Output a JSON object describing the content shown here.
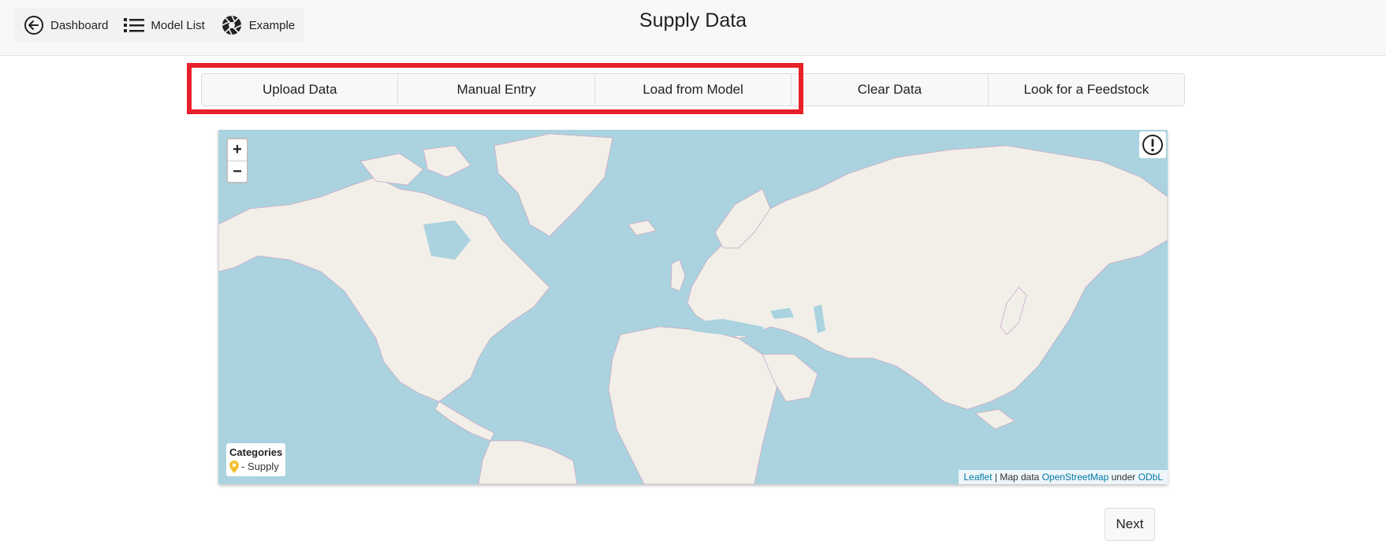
{
  "nav": {
    "dashboard": {
      "label": "Dashboard",
      "icon": "arrow-left-circle-icon"
    },
    "model_list": {
      "label": "Model List",
      "icon": "list-icon"
    },
    "example": {
      "label": "Example",
      "icon": "aperture-icon"
    }
  },
  "page_title": "Supply Data",
  "toolbar": {
    "upload": "Upload Data",
    "manual": "Manual Entry",
    "load_model": "Load from Model",
    "clear": "Clear Data",
    "feedstock": "Look for a Feedstock"
  },
  "highlight_color": "#e8202a",
  "map": {
    "zoom_in": "+",
    "zoom_out": "−",
    "info_icon": "exclamation-circle-icon",
    "legend": {
      "title": "Categories",
      "item": "- Supply",
      "marker_color": "#f2c230"
    },
    "attribution": {
      "leaflet": "Leaflet",
      "sep1": " | Map data ",
      "osm": "OpenStreetMap",
      "sep2": " under ",
      "odbl": "ODbL"
    },
    "colors": {
      "water": "#aad3df",
      "land": "#f2efe9",
      "border": "#c9a9c4"
    }
  },
  "next_label": "Next"
}
